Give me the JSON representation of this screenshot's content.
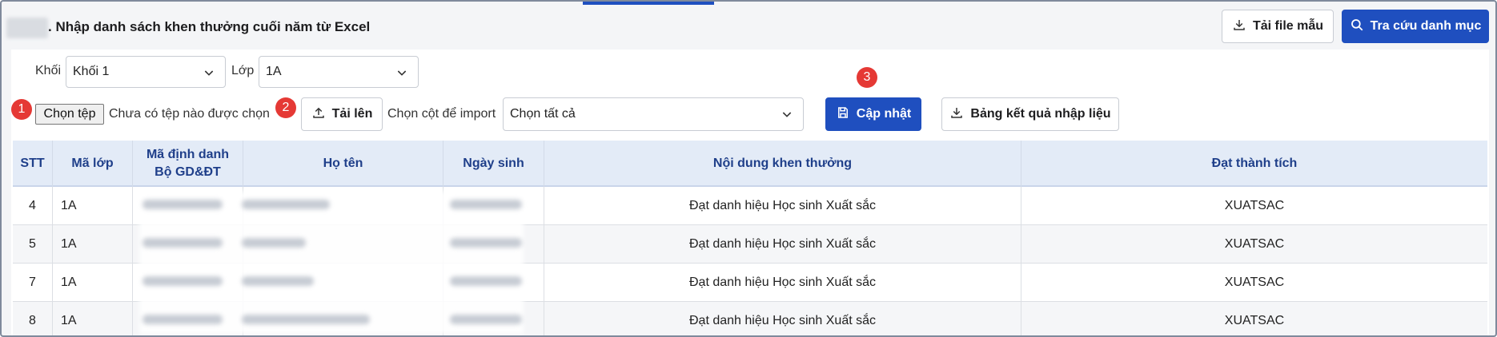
{
  "header": {
    "title": ". Nhập danh sách khen thưởng cuối năm từ Excel",
    "download_template_label": "Tải file mẫu",
    "lookup_label": "Tra cứu danh mục"
  },
  "filters": {
    "khoi_label": "Khối",
    "khoi_value": "Khối 1",
    "lop_label": "Lớp",
    "lop_value": "1A"
  },
  "import": {
    "choose_file_label": "Chọn tệp",
    "file_status": "Chưa có tệp nào được chọn",
    "upload_label": "Tải lên",
    "choose_columns_label": "Chọn cột để import",
    "choose_columns_value": "Chọn tất cả",
    "update_label": "Cập nhật",
    "results_label": "Bảng kết quả nhập liệu"
  },
  "steps": [
    "1",
    "2",
    "3"
  ],
  "table": {
    "headers": {
      "stt": "STT",
      "ma_lop": "Mã lớp",
      "ma_dinh_danh_1": "Mã định danh",
      "ma_dinh_danh_2": "Bộ GD&ĐT",
      "ho_ten": "Họ tên",
      "ngay_sinh": "Ngày sinh",
      "noi_dung": "Nội dung khen thưởng",
      "dat_thanh_tich": "Đạt thành tích"
    },
    "rows": [
      {
        "stt": "4",
        "ma_lop": "1A",
        "noi_dung": "Đạt danh hiệu Học sinh Xuất sắc",
        "dat_thanh_tich": "XUATSAC"
      },
      {
        "stt": "5",
        "ma_lop": "1A",
        "noi_dung": "Đạt danh hiệu Học sinh Xuất sắc",
        "dat_thanh_tich": "XUATSAC"
      },
      {
        "stt": "7",
        "ma_lop": "1A",
        "noi_dung": "Đạt danh hiệu Học sinh Xuất sắc",
        "dat_thanh_tich": "XUATSAC"
      },
      {
        "stt": "8",
        "ma_lop": "1A",
        "noi_dung": "Đạt danh hiệu Học sinh Xuất sắc",
        "dat_thanh_tich": "XUATSAC"
      }
    ]
  },
  "colors": {
    "primary": "#1f4fbf",
    "step_badge": "#e53935",
    "header_bg": "#e3ebf7"
  }
}
